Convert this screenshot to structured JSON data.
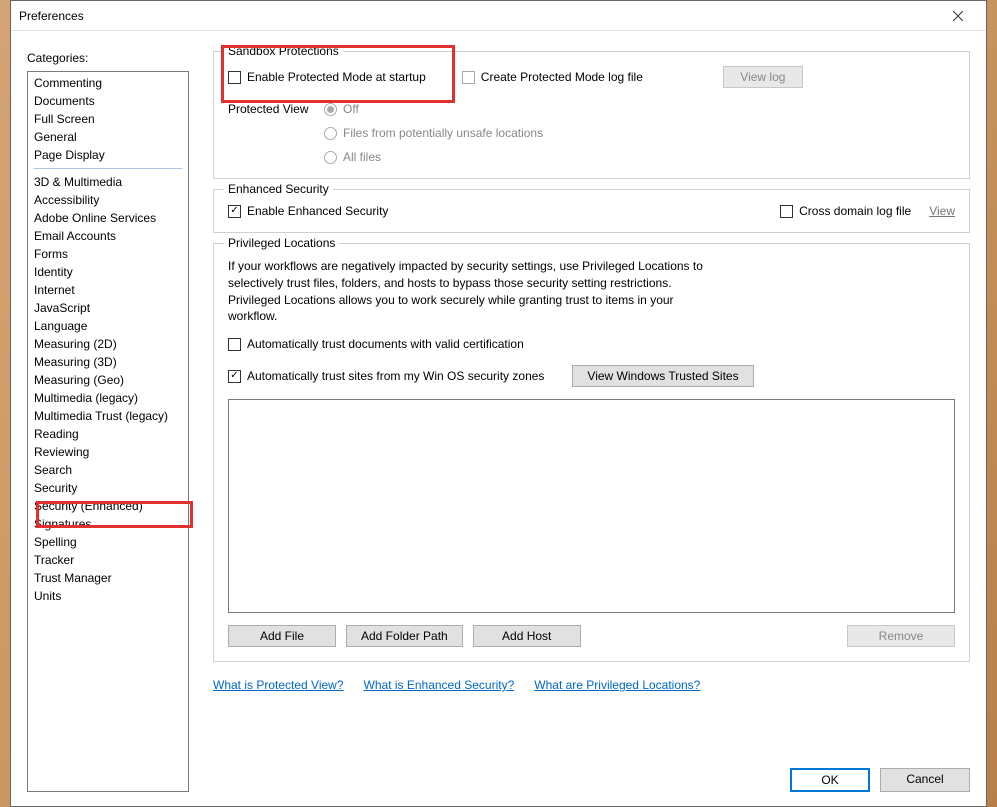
{
  "window": {
    "title": "Preferences"
  },
  "categories_label": "Categories:",
  "categories_top": [
    "Commenting",
    "Documents",
    "Full Screen",
    "General",
    "Page Display"
  ],
  "categories_bottom": [
    "3D & Multimedia",
    "Accessibility",
    "Adobe Online Services",
    "Email Accounts",
    "Forms",
    "Identity",
    "Internet",
    "JavaScript",
    "Language",
    "Measuring (2D)",
    "Measuring (3D)",
    "Measuring (Geo)",
    "Multimedia (legacy)",
    "Multimedia Trust (legacy)",
    "Reading",
    "Reviewing",
    "Search",
    "Security",
    "Security (Enhanced)",
    "Signatures",
    "Spelling",
    "Tracker",
    "Trust Manager",
    "Units"
  ],
  "sandbox": {
    "legend": "Sandbox Protections",
    "enable_protected": "Enable Protected Mode at startup",
    "create_log": "Create Protected Mode log file",
    "view_log_btn": "View log",
    "protected_view_label": "Protected View",
    "pv_off": "Off",
    "pv_unsafe": "Files from potentially unsafe locations",
    "pv_all": "All files"
  },
  "enhanced": {
    "legend": "Enhanced Security",
    "enable": "Enable Enhanced Security",
    "cross_domain": "Cross domain log file",
    "view_link": "View"
  },
  "privileged": {
    "legend": "Privileged Locations",
    "help": "If your workflows are negatively impacted by security settings, use Privileged Locations to selectively trust files, folders, and hosts to bypass those security setting restrictions. Privileged Locations allows you to work securely while granting trust to items in your workflow.",
    "auto_trust_cert": "Automatically trust documents with valid certification",
    "auto_trust_zones": "Automatically trust sites from my Win OS security zones",
    "view_trusted_btn": "View Windows Trusted Sites",
    "add_file_btn": "Add File",
    "add_folder_btn": "Add Folder Path",
    "add_host_btn": "Add Host",
    "remove_btn": "Remove"
  },
  "links": {
    "protected_view": "What is Protected View?",
    "enhanced_security": "What is Enhanced Security?",
    "privileged_locations": "What are Privileged Locations?"
  },
  "footer": {
    "ok": "OK",
    "cancel": "Cancel"
  }
}
